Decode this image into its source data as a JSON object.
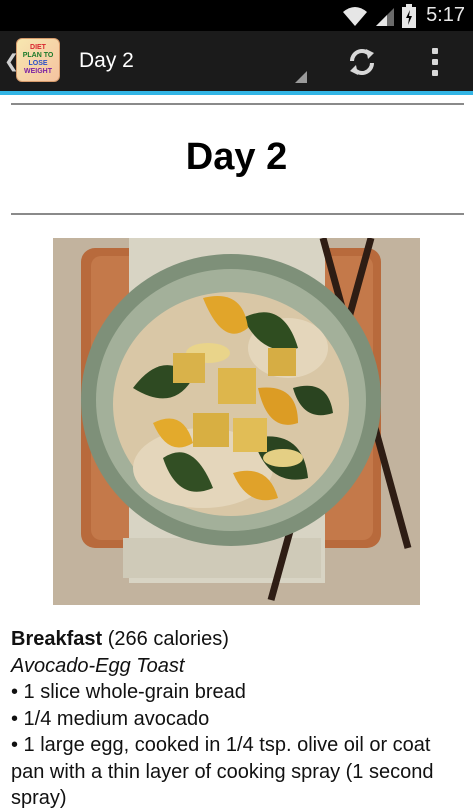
{
  "status_bar": {
    "time": "5:17"
  },
  "action_bar": {
    "title": "Day 2",
    "logo_lines": [
      "DIET",
      "PLAN TO",
      "LOSE",
      "WEIGHT"
    ],
    "refresh_icon": "refresh-icon",
    "overflow_icon": "overflow-menu-icon"
  },
  "page": {
    "heading": "Day 2",
    "image_icon": "food-bowl-photo",
    "breakfast": {
      "label": "Breakfast",
      "calories": " (266 calories)",
      "recipe": "Avocado-Egg Toast",
      "items": [
        "• 1 slice whole-grain bread",
        "• 1/4 medium avocado",
        "• 1 large egg, cooked in 1/4 tsp. olive oil or coat pan with a thin layer of cooking spray (1 second spray)"
      ]
    }
  },
  "colors": {
    "accent": "#33b5e5",
    "action_bar": "#1b1b1b"
  }
}
